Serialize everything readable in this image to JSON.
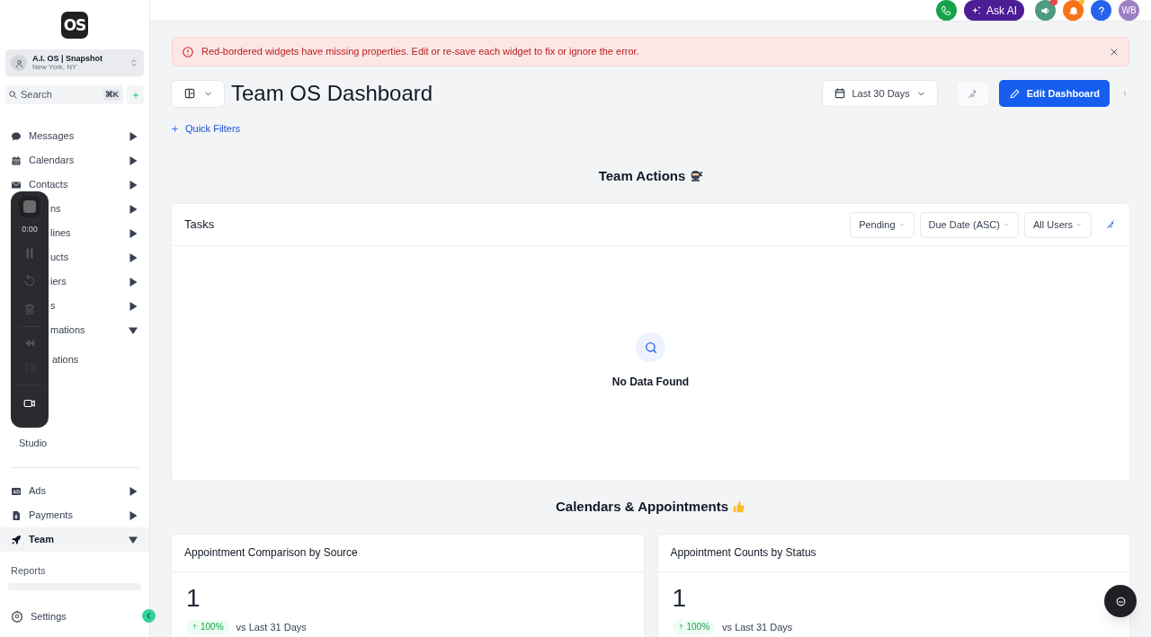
{
  "sidebar": {
    "logo": "OS",
    "account": {
      "name": "A.I. OS | Snapshot",
      "location": "New York, NY"
    },
    "search": {
      "placeholder": "Search",
      "shortcut": "⌘K"
    },
    "items": [
      {
        "label": "Messages",
        "kind": "chat",
        "expanded": false
      },
      {
        "label": "Calendars",
        "kind": "calendar",
        "expanded": false
      },
      {
        "label": "Contacts",
        "kind": "mail",
        "expanded": false
      },
      {
        "label": "ns",
        "kind": "covered",
        "expanded": false
      },
      {
        "label": "lines",
        "kind": "covered",
        "expanded": false
      },
      {
        "label": "ucts",
        "kind": "covered",
        "expanded": false
      },
      {
        "label": "iers",
        "kind": "covered",
        "expanded": false
      },
      {
        "label": "s",
        "kind": "covered",
        "expanded": false
      },
      {
        "label": "mations",
        "kind": "covered",
        "expanded": true
      }
    ],
    "sub_items": [
      {
        "label": "ations"
      },
      {
        "label": "Studio"
      }
    ],
    "recorder": {
      "time": "0:00"
    },
    "bottom_items": [
      {
        "label": "Ads",
        "kind": "ad",
        "expanded": false,
        "selected": false
      },
      {
        "label": "Payments",
        "kind": "invoice",
        "expanded": false,
        "selected": false
      },
      {
        "label": "Team",
        "kind": "rocket",
        "expanded": true,
        "selected": true
      }
    ],
    "team_sub_items": [
      {
        "label": "Reports",
        "selected": false
      },
      {
        "selected": true
      }
    ],
    "settings": "Settings"
  },
  "topbar": {
    "ask_ai": "Ask AI",
    "avatar": "WB",
    "megaphone_badge": true,
    "bell_badge": true
  },
  "banner": {
    "message": "Red-bordered widgets have missing properties. Edit or re-save each widget to fix or ignore the error."
  },
  "header": {
    "title": "Team OS Dashboard",
    "date_range": "Last 30 Days",
    "edit_button": "Edit Dashboard",
    "quick_filters": "Quick Filters"
  },
  "sections": [
    {
      "title": "Team Actions",
      "kind": "ninja"
    },
    {
      "title": "Calendars & Appointments",
      "kind": "thumbs"
    }
  ],
  "tasks": {
    "title": "Tasks",
    "filters": [
      "Pending",
      "Due Date (ASC)",
      "All Users"
    ],
    "empty": "No Data Found"
  },
  "stat_cards": [
    {
      "title": "Appointment Comparison by Source",
      "value": "1",
      "change": "100%",
      "compare": "vs Last 31 Days"
    },
    {
      "title": "Appointment Counts by Status",
      "value": "1",
      "change": "100%",
      "compare": "vs Last 31 Days"
    }
  ]
}
